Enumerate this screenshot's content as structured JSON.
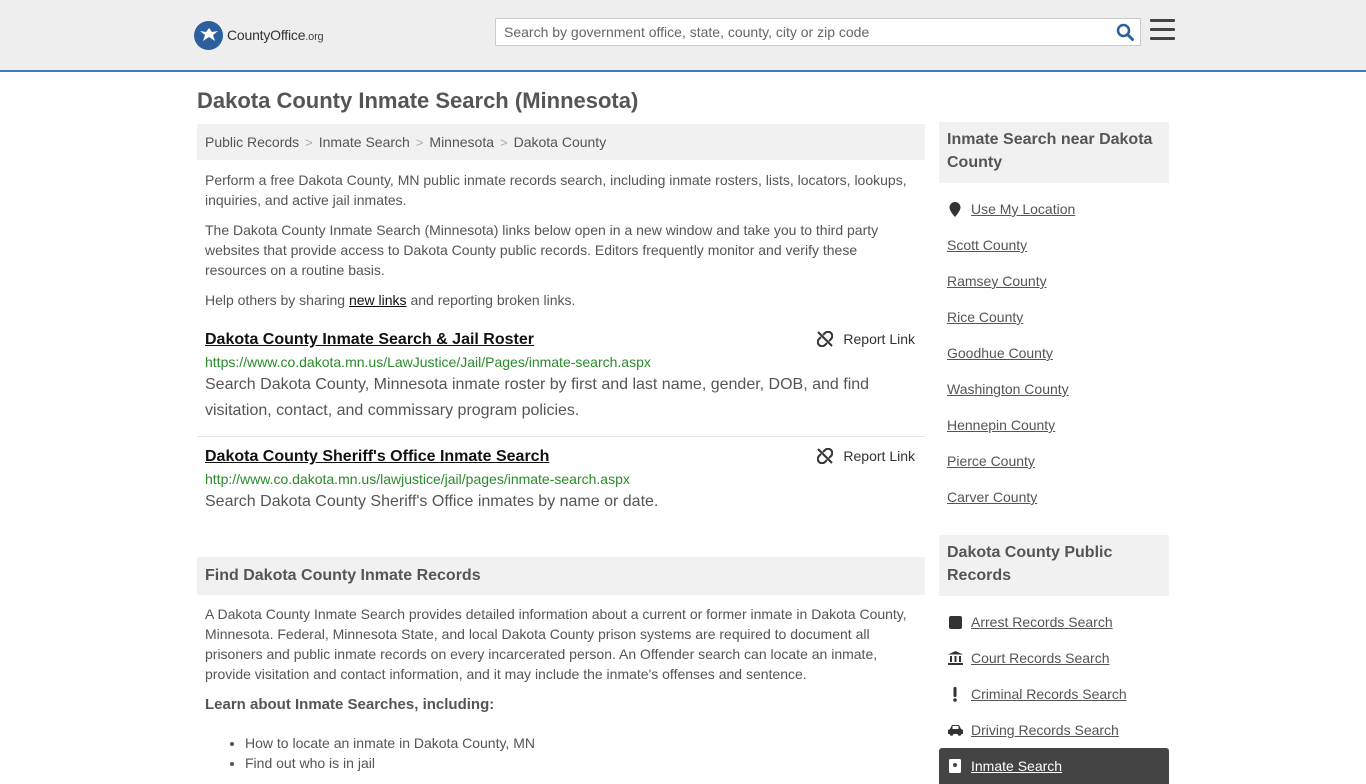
{
  "header": {
    "logo_county": "County",
    "logo_office": "Office",
    "logo_tld": ".org",
    "search_placeholder": "Search by government office, state, county, city or zip code"
  },
  "page_title": "Dakota County Inmate Search (Minnesota)",
  "breadcrumb": [
    "Public Records",
    "Inmate Search",
    "Minnesota",
    "Dakota County"
  ],
  "intro": {
    "p1": "Perform a free Dakota County, MN public inmate records search, including inmate rosters, lists, locators, lookups, inquiries, and active jail inmates.",
    "p2": "The Dakota County Inmate Search (Minnesota) links below open in a new window and take you to third party websites that provide access to Dakota County public records. Editors frequently monitor and verify these resources on a routine basis.",
    "p3_before": "Help others by sharing ",
    "p3_link": "new links",
    "p3_after": " and reporting broken links."
  },
  "results": [
    {
      "title": "Dakota County Inmate Search & Jail Roster",
      "url": "https://www.co.dakota.mn.us/LawJustice/Jail/Pages/inmate-search.aspx",
      "description": "Search Dakota County, Minnesota inmate roster by first and last name, gender, DOB, and find visitation, contact, and commissary program policies.",
      "report_label": "Report Link"
    },
    {
      "title": "Dakota County Sheriff's Office Inmate Search",
      "url": "http://www.co.dakota.mn.us/lawjustice/jail/pages/inmate-search.aspx",
      "description": "Search Dakota County Sheriff's Office inmates by name or date.",
      "report_label": "Report Link"
    }
  ],
  "find_section": {
    "heading": "Find Dakota County Inmate Records",
    "body": "A Dakota County Inmate Search provides detailed information about a current or former inmate in Dakota County, Minnesota. Federal, Minnesota State, and local Dakota County prison systems are required to document all prisoners and public inmate records on every incarcerated person. An Offender search can locate an inmate, provide visitation and contact information, and it may include the inmate's offenses and sentence.",
    "learn_label": "Learn about Inmate Searches, including:",
    "bullets": [
      "How to locate an inmate in Dakota County, MN",
      "Find out who is in jail"
    ]
  },
  "sidebar": {
    "near_heading": "Inmate Search near Dakota County",
    "near_items": [
      "Use My Location",
      "Scott County",
      "Ramsey County",
      "Rice County",
      "Goodhue County",
      "Washington County",
      "Hennepin County",
      "Pierce County",
      "Carver County"
    ],
    "records_heading": "Dakota County Public Records",
    "records_items": [
      "Arrest Records Search",
      "Court Records Search",
      "Criminal Records Search",
      "Driving Records Search",
      "Inmate Search"
    ]
  },
  "colors": {
    "accent_border": "#3a7bbf",
    "link_green": "#2a8a2a",
    "active_item_bg": "#444444"
  }
}
